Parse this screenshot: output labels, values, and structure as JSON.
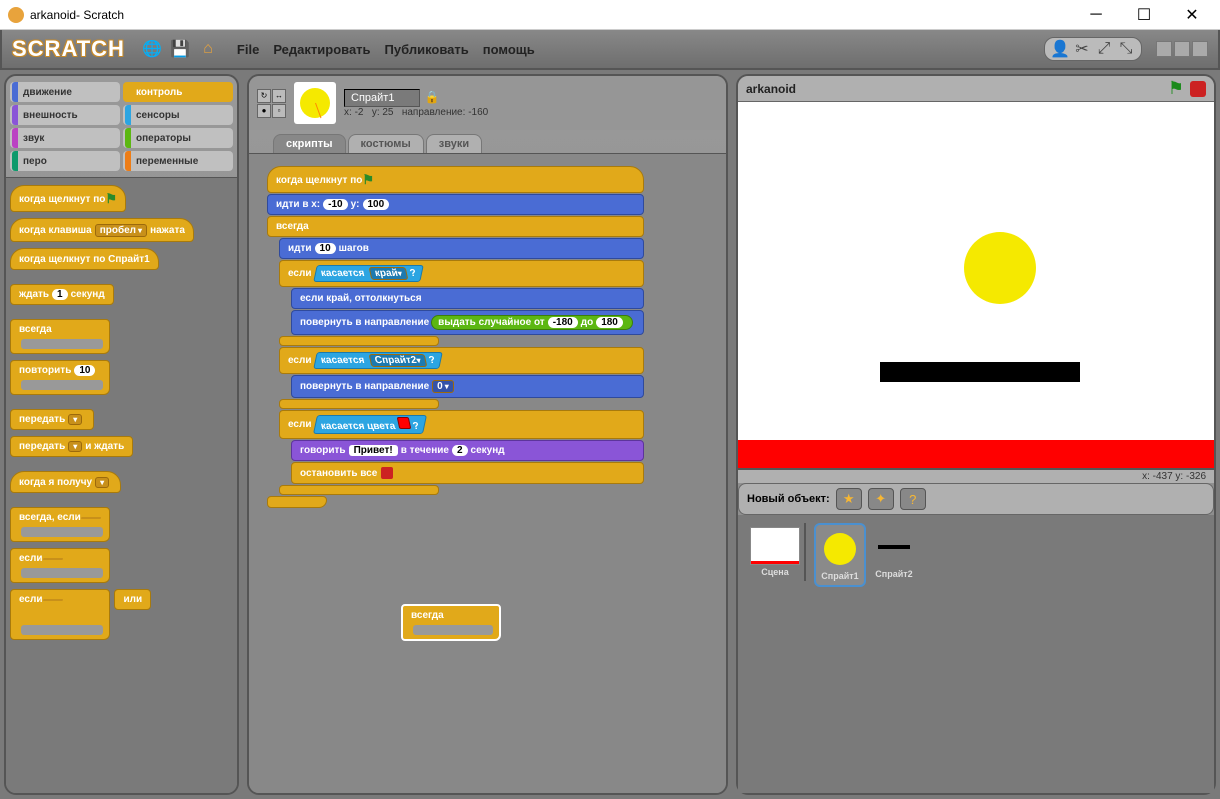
{
  "window": {
    "title": "arkanoid- Scratch"
  },
  "app": {
    "logo": "SCRATCH"
  },
  "menu": {
    "file": "File",
    "edit": "Редактировать",
    "publish": "Публиковать",
    "help": "помощь"
  },
  "categories": {
    "motion": "движение",
    "control": "контроль",
    "looks": "внешность",
    "sensing": "сенсоры",
    "sound": "звук",
    "operators": "операторы",
    "pen": "перо",
    "variables": "переменные"
  },
  "palette": {
    "whenFlag": "когда щелкнут по",
    "whenKey": "когда клавиша",
    "keySpace": "пробел",
    "pressed": "нажата",
    "whenSprite": "когда щелкнут по  Спрайт1",
    "waitSecs": "ждать",
    "waitVal": "1",
    "secs": "секунд",
    "forever": "всегда",
    "repeat": "повторить",
    "repeatVal": "10",
    "broadcast": "передать",
    "broadcastWait": "передать",
    "andWait": "и ждать",
    "whenReceive": "когда я получу",
    "foreverIf": "всегда, если",
    "if": "если",
    "ifElse": "если",
    "else": "или"
  },
  "sprite": {
    "name": "Спрайт1",
    "x": "-2",
    "y": "25",
    "dir": "-160",
    "xlbl": "x:",
    "ylbl": "y:",
    "dirlbl": "направление:"
  },
  "tabs": {
    "scripts": "скрипты",
    "costumes": "костюмы",
    "sounds": "звуки"
  },
  "script": {
    "whenFlag": "когда щелкнут по",
    "gotoXY": "идти в x:",
    "gx": "-10",
    "gylbl": "y:",
    "gy": "100",
    "forever": "всегда",
    "move": "идти",
    "steps": "10",
    "stepsLbl": "шагов",
    "if": "если",
    "touching": "касается",
    "edge": "край",
    "q": "?",
    "bounce": "если край, оттолкнуться",
    "pointDir": "повернуть в направление",
    "random": "выдать случайное от",
    "rmin": "-180",
    "to": "до",
    "rmax": "180",
    "sprite2": "Спрайт2",
    "zero": "0",
    "touchColor": "касается цвета",
    "say": "говорить",
    "hello": "Привет!",
    "for": "в течение",
    "sayN": "2",
    "sec": "секунд",
    "stopAll": "остановить все"
  },
  "detached": {
    "forever": "всегда"
  },
  "stage": {
    "title": "arkanoid",
    "coords": "x: -437   y: -326",
    "newObject": "Новый объект:"
  },
  "sprites": {
    "scene": "Сцена",
    "s1": "Спрайт1",
    "s2": "Спрайт2"
  }
}
